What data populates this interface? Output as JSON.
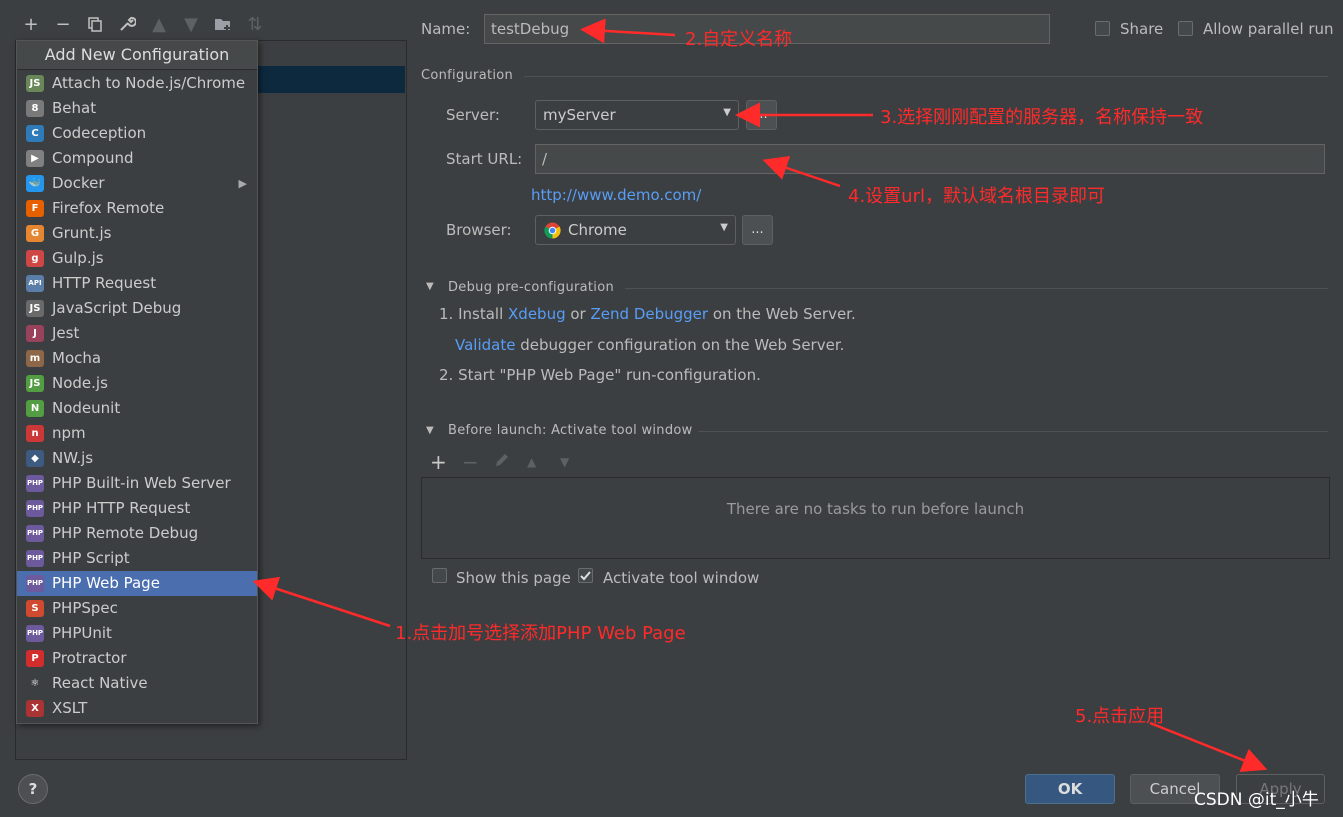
{
  "toolbar": {
    "icons": [
      "add-icon",
      "remove-icon",
      "copy-icon",
      "wrench-icon",
      "move-up-icon",
      "move-down-icon",
      "folder-add-icon",
      "sort-icon"
    ]
  },
  "popup": {
    "header": "Add New Configuration",
    "items": [
      {
        "label": "Attach to Node.js/Chrome",
        "icon": "node-attach-icon",
        "color": "#6a8759",
        "glyph": "JS"
      },
      {
        "label": "Behat",
        "icon": "behat-icon",
        "color": "#7a7a7a",
        "glyph": "8"
      },
      {
        "label": "Codeception",
        "icon": "codeception-icon",
        "color": "#2f7ab8",
        "glyph": "C"
      },
      {
        "label": "Compound",
        "icon": "compound-icon",
        "color": "#808080",
        "glyph": "▶"
      },
      {
        "label": "Docker",
        "icon": "docker-icon",
        "color": "#2496ed",
        "glyph": "🐳",
        "submenu": true
      },
      {
        "label": "Firefox Remote",
        "icon": "firefox-icon",
        "color": "#e66000",
        "glyph": "F"
      },
      {
        "label": "Grunt.js",
        "icon": "grunt-icon",
        "color": "#e48632",
        "glyph": "G"
      },
      {
        "label": "Gulp.js",
        "icon": "gulp-icon",
        "color": "#cf4647",
        "glyph": "g"
      },
      {
        "label": "HTTP Request",
        "icon": "http-request-icon",
        "color": "#5a7ea8",
        "glyph": "API"
      },
      {
        "label": "JavaScript Debug",
        "icon": "js-debug-icon",
        "color": "#6a6a6a",
        "glyph": "JS"
      },
      {
        "label": "Jest",
        "icon": "jest-icon",
        "color": "#99425b",
        "glyph": "J"
      },
      {
        "label": "Mocha",
        "icon": "mocha-icon",
        "color": "#8d6748",
        "glyph": "m"
      },
      {
        "label": "Node.js",
        "icon": "nodejs-icon",
        "color": "#539e43",
        "glyph": "JS"
      },
      {
        "label": "Nodeunit",
        "icon": "nodeunit-icon",
        "color": "#539e43",
        "glyph": "N"
      },
      {
        "label": "npm",
        "icon": "npm-icon",
        "color": "#cb3837",
        "glyph": "n"
      },
      {
        "label": "NW.js",
        "icon": "nwjs-icon",
        "color": "#3d5a80",
        "glyph": "◆"
      },
      {
        "label": "PHP Built-in Web Server",
        "icon": "php-server-icon",
        "color": "#6c5a9c",
        "glyph": "PHP"
      },
      {
        "label": "PHP HTTP Request",
        "icon": "php-http-icon",
        "color": "#6c5a9c",
        "glyph": "PHP"
      },
      {
        "label": "PHP Remote Debug",
        "icon": "php-remote-debug-icon",
        "color": "#6c5a9c",
        "glyph": "PHP"
      },
      {
        "label": "PHP Script",
        "icon": "php-script-icon",
        "color": "#6c5a9c",
        "glyph": "PHP"
      },
      {
        "label": "PHP Web Page",
        "icon": "php-web-page-icon",
        "color": "#6c5a9c",
        "glyph": "PHP",
        "selected": true
      },
      {
        "label": "PHPSpec",
        "icon": "phpspec-icon",
        "color": "#d04a30",
        "glyph": "S"
      },
      {
        "label": "PHPUnit",
        "icon": "phpunit-icon",
        "color": "#6c5a9c",
        "glyph": "PHP"
      },
      {
        "label": "Protractor",
        "icon": "protractor-icon",
        "color": "#d22d2d",
        "glyph": "P"
      },
      {
        "label": "React Native",
        "icon": "react-icon",
        "color": "#3c3f41",
        "glyph": "⚛"
      },
      {
        "label": "XSLT",
        "icon": "xslt-icon",
        "color": "#a33",
        "glyph": "X"
      }
    ]
  },
  "form": {
    "name_label": "Name:",
    "name_value": "testDebug",
    "share_label": "Share",
    "parallel_label": "Allow parallel run",
    "configuration_title": "Configuration",
    "server_label": "Server:",
    "server_value": "myServer",
    "start_url_label": "Start URL:",
    "start_url_value": "/",
    "url_hint": "http://www.demo.com/",
    "browser_label": "Browser:",
    "browser_value": "Chrome",
    "dots": "...",
    "debug_title": "Debug pre-configuration",
    "step1_prefix": "1. Install",
    "xdebug": "Xdebug",
    "or": "or",
    "zend": "Zend Debugger",
    "step1_suffix": "on the Web Server.",
    "validate": "Validate",
    "validate_suffix": "debugger configuration on the Web Server.",
    "step2": "2. Start \"PHP Web Page\" run-configuration.",
    "before_launch_title": "Before launch: Activate tool window",
    "no_tasks": "There are no tasks to run before launch",
    "show_page_label": "Show this page",
    "activate_label": "Activate tool window"
  },
  "buttons": {
    "help": "?",
    "ok": "OK",
    "cancel": "Cancel",
    "apply": "Apply"
  },
  "annotations": {
    "a1": "1.点击加号选择添加PHP Web Page",
    "a2": "2.自定义名称",
    "a3": "3.选择刚刚配置的服务器，名称保持一致",
    "a4": "4.设置url，默认域名根目录即可",
    "a5": "5.点击应用"
  },
  "watermark": "CSDN @it_小牛",
  "colors": {
    "background": "#3c3f41",
    "selection": "#4b6eaf",
    "link": "#589df6",
    "annotation": "#ff2a2a",
    "ok_button": "#365880"
  }
}
